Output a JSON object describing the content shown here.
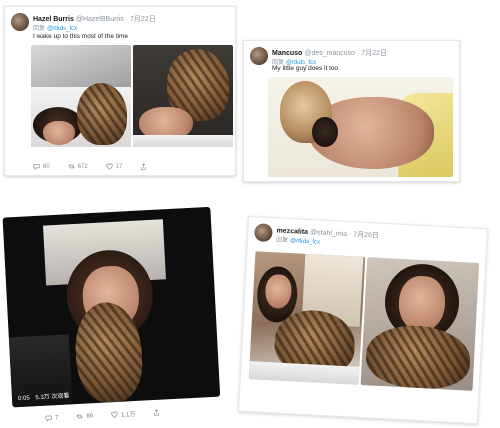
{
  "tweets": [
    {
      "name": "Hazel Burris",
      "handle": "@HazelBBurris · 7月22日",
      "reply_prefix": "回复",
      "reply_to": "@rtkds_fcx",
      "text": "I wake up to this most of the time",
      "stats": {
        "replies": "60",
        "retweets": "672",
        "likes": "17"
      }
    },
    {
      "name": "Mancuso",
      "handle": "@des_mancuso · 7月22日",
      "reply_prefix": "回复",
      "reply_to": "@rtkds_fcx",
      "text": "My little guy does it too"
    },
    {
      "video_time": "0:05",
      "video_views": "5.3万 次观看",
      "stats": {
        "replies": "7",
        "retweets": "86",
        "likes": "1.1万"
      }
    },
    {
      "name": "mezcalita",
      "handle": "@stahl_mia · 7月26日",
      "reply_prefix": "回复",
      "reply_to": "@rtkds_fcx"
    }
  ],
  "icons": {
    "reply": "reply-icon",
    "retweet": "retweet-icon",
    "like": "heart-icon",
    "share": "share-icon"
  },
  "colors": {
    "link": "#1d95e0",
    "muted": "#8a949d",
    "text": "#14171a"
  }
}
